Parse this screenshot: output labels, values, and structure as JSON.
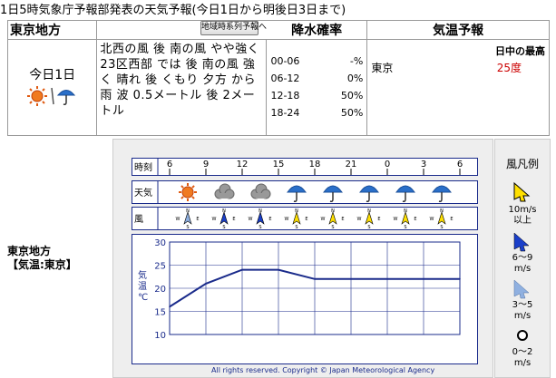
{
  "headline": "1日5時気象庁予報部発表の天気予報(今日1日から明後日3日まで)",
  "table": {
    "region_header": "東京地方",
    "rain_header": "降水確率",
    "temp_header": "気温予報",
    "timeseries_button": "地域時系列予報へ",
    "day_label": "今日1日",
    "description": "北西の風 後 南の風 やや強く 23区西部 では 後 南の風 強く 晴れ 後 くもり 夕方 から 雨 波 0.5メートル 後 2メートル",
    "rain": [
      {
        "period": "00-06",
        "value": "-%"
      },
      {
        "period": "06-12",
        "value": "0%"
      },
      {
        "period": "12-18",
        "value": "50%"
      },
      {
        "period": "18-24",
        "value": "50%"
      }
    ],
    "temp_city": "東京",
    "temp_daytime_max_label": "日中の最高",
    "temp_max_value": "25度"
  },
  "left_label": {
    "line1": "東京地方",
    "line2": "【気温:東京】"
  },
  "timeseries": {
    "time_label": "時刻",
    "weather_label": "天気",
    "wind_label": "風",
    "hours": [
      "6",
      "9",
      "12",
      "15",
      "18",
      "21",
      "0",
      "3",
      "6"
    ],
    "weather_icons": [
      "sun-icon",
      "cloud-icon",
      "cloud-icon",
      "umbrella-icon",
      "umbrella-icon",
      "umbrella-icon",
      "umbrella-icon",
      "umbrella-icon"
    ],
    "wind_dirs": [
      "N",
      "N",
      "N",
      "S",
      "S",
      "S",
      "S",
      "S"
    ],
    "wind_strength": [
      "light",
      "mid",
      "mid",
      "strong",
      "strong",
      "strong",
      "strong",
      "strong"
    ],
    "compass": {
      "n": "N",
      "w": "W",
      "e": "E",
      "s": "S"
    },
    "copyright": "All rights reserved. Copyright © Japan Meteorological Agency"
  },
  "legend": {
    "title": "風凡例",
    "items": [
      {
        "label1": "10m/s",
        "label2": "以上"
      },
      {
        "label1": "6～9",
        "label2": "m/s"
      },
      {
        "label1": "3～5",
        "label2": "m/s"
      },
      {
        "label1": "0～2",
        "label2": "m/s"
      }
    ]
  },
  "colors": {
    "accent": "#1a2b8b",
    "max_temp": "#cc0000",
    "panel": "#eeeeee",
    "umbrella": "#2a6fc9",
    "sun": "#e05a10"
  },
  "chart_data": {
    "type": "line",
    "ylabel": "気温℃",
    "ylim": [
      10,
      30
    ],
    "yticks": [
      30,
      25,
      20,
      15,
      10
    ],
    "x": [
      "6",
      "9",
      "12",
      "15",
      "18",
      "21",
      "0",
      "3",
      "6"
    ],
    "series": [
      {
        "values": [
          16,
          21,
          24,
          24,
          22,
          22,
          22,
          22,
          22
        ]
      }
    ]
  }
}
